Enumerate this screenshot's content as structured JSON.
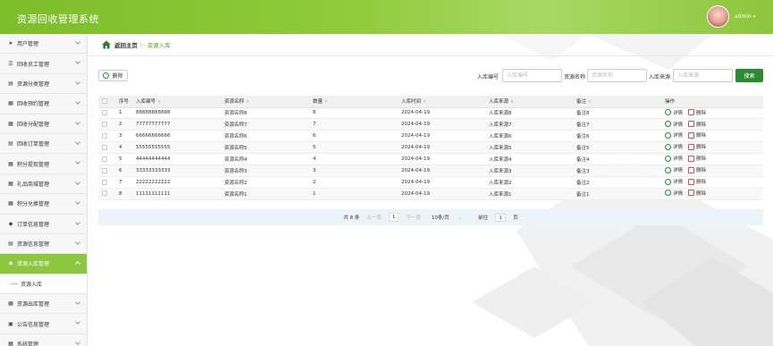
{
  "header": {
    "title": "资源回收管理系统",
    "username": "admin",
    "caret": "▾"
  },
  "sidebar": {
    "items": [
      {
        "label": "用户管理",
        "icon": "send-icon",
        "glyph": "➤"
      },
      {
        "label": "回收员工管理",
        "icon": "sliders-icon",
        "glyph": "☰"
      },
      {
        "label": "资源分类管理",
        "icon": "stack-icon",
        "glyph": "▤"
      },
      {
        "label": "回收预约管理",
        "icon": "calendar-icon",
        "glyph": "▦"
      },
      {
        "label": "回收分配管理",
        "icon": "grid-icon",
        "glyph": "▦"
      },
      {
        "label": "回收订单管理",
        "icon": "document-icon",
        "glyph": "▤"
      },
      {
        "label": "积分提现管理",
        "icon": "grid-icon",
        "glyph": "▦"
      },
      {
        "label": "礼品商城管理",
        "icon": "grid-icon",
        "glyph": "▦"
      },
      {
        "label": "积分兑换管理",
        "icon": "grid-icon",
        "glyph": "▦"
      },
      {
        "label": "订单信息管理",
        "icon": "shield-icon",
        "glyph": "◆"
      },
      {
        "label": "资源信息管理",
        "icon": "document-icon",
        "glyph": "▤"
      },
      {
        "label": "资源入库管理",
        "icon": "shield-icon",
        "glyph": "◆",
        "active": true
      },
      {
        "label": "资源出库管理",
        "icon": "grid-icon",
        "glyph": "▦"
      },
      {
        "label": "公告信息管理",
        "icon": "layout-icon",
        "glyph": "▣"
      },
      {
        "label": "系统管理",
        "icon": "grid-icon",
        "glyph": "▦"
      }
    ],
    "submenu_label": "资源入库"
  },
  "breadcrumb": {
    "home": "返回主页",
    "separator": "▷",
    "current": "资源入库"
  },
  "toolbar": {
    "delete_label": "删除",
    "delete_glyph": "−"
  },
  "search": {
    "fields": [
      {
        "label": "入库编号",
        "placeholder": "入库编号"
      },
      {
        "label": "资源名称",
        "placeholder": "资源名称"
      },
      {
        "label": "入库来源",
        "placeholder": "入库来源"
      }
    ],
    "button_label": "搜索"
  },
  "table": {
    "headers": [
      "序号",
      "入库编号",
      "资源名称",
      "数量",
      "入库时间",
      "入库来源",
      "备注",
      "操作"
    ],
    "sort_glyph": "⇕",
    "detail_label": "详情",
    "delete_label": "删除",
    "rows": [
      {
        "index": "1",
        "code": "88888888888",
        "name": "资源名称8",
        "qty": "8",
        "time": "2024-04-19",
        "source": "入库来源8",
        "remark": "备注8"
      },
      {
        "index": "2",
        "code": "77777777777",
        "name": "资源名称7",
        "qty": "7",
        "time": "2024-04-19",
        "source": "入库来源7",
        "remark": "备注7"
      },
      {
        "index": "3",
        "code": "66666666666",
        "name": "资源名称6",
        "qty": "6",
        "time": "2024-04-19",
        "source": "入库来源6",
        "remark": "备注6"
      },
      {
        "index": "4",
        "code": "55555555555",
        "name": "资源名称5",
        "qty": "5",
        "time": "2024-04-19",
        "source": "入库来源5",
        "remark": "备注5"
      },
      {
        "index": "5",
        "code": "44444444444",
        "name": "资源名称4",
        "qty": "4",
        "time": "2024-04-19",
        "source": "入库来源4",
        "remark": "备注4"
      },
      {
        "index": "6",
        "code": "33333333333",
        "name": "资源名称3",
        "qty": "3",
        "time": "2024-04-19",
        "source": "入库来源3",
        "remark": "备注3"
      },
      {
        "index": "7",
        "code": "22222222222",
        "name": "资源名称2",
        "qty": "2",
        "time": "2024-04-19",
        "source": "入库来源2",
        "remark": "备注2"
      },
      {
        "index": "8",
        "code": "11111111111",
        "name": "资源名称1",
        "qty": "1",
        "time": "2024-04-19",
        "source": "入库来源1",
        "remark": "备注1"
      }
    ]
  },
  "pager": {
    "total": "共 8 条",
    "prev": "上一页",
    "page": "1",
    "next": "下一页",
    "page_size": "10条/页",
    "page_size_caret": "⌄",
    "goto_label": "前往",
    "goto_value": "1",
    "goto_suffix": "页"
  },
  "colors": {
    "accent": "#8dc63f",
    "search_button": "#2a8b33",
    "header": "#8dc63f"
  }
}
